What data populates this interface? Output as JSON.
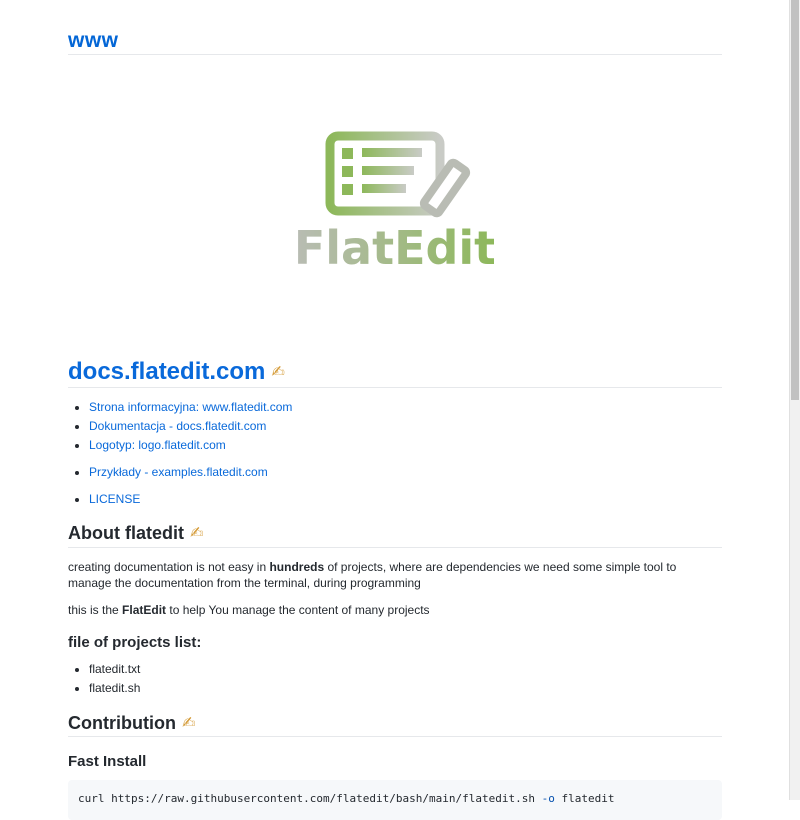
{
  "site": {
    "title": "www"
  },
  "logo": {
    "wordmark": "FlatEdit"
  },
  "page": {
    "title": "docs.flatedit.com",
    "title_emoji": "✍"
  },
  "links": [
    {
      "label": "Strona informacyjna: www.flatedit.com"
    },
    {
      "label": "Dokumentacja - docs.flatedit.com"
    },
    {
      "label": "Logotyp: logo.flatedit.com"
    },
    {
      "label": "Przykłady - examples.flatedit.com"
    },
    {
      "label": "LICENSE"
    }
  ],
  "about": {
    "heading": "About flatedit",
    "emoji": "✍",
    "p1_before": "creating documentation is not easy in ",
    "p1_bold": "hundreds",
    "p1_after": " of projects, where are dependencies we need some simple tool to manage the documentation from the terminal, during programming",
    "p2_before": "this is the ",
    "p2_bold": "FlatEdit",
    "p2_after": " to help You manage the content of many projects"
  },
  "files_section": {
    "heading": "file of projects list:",
    "items": [
      "flatedit.txt",
      "flatedit.sh"
    ]
  },
  "contribution": {
    "heading": "Contribution",
    "emoji": "✍",
    "subheading": "Fast Install",
    "code_cmd": "curl https://raw.githubusercontent.com/flatedit/bash/main/flatedit.sh",
    "code_opt": "-o",
    "code_arg": "flatedit"
  },
  "colors": {
    "link": "#0969da",
    "logo_green": "#8db85a",
    "logo_gray": "#b9bcb4"
  }
}
